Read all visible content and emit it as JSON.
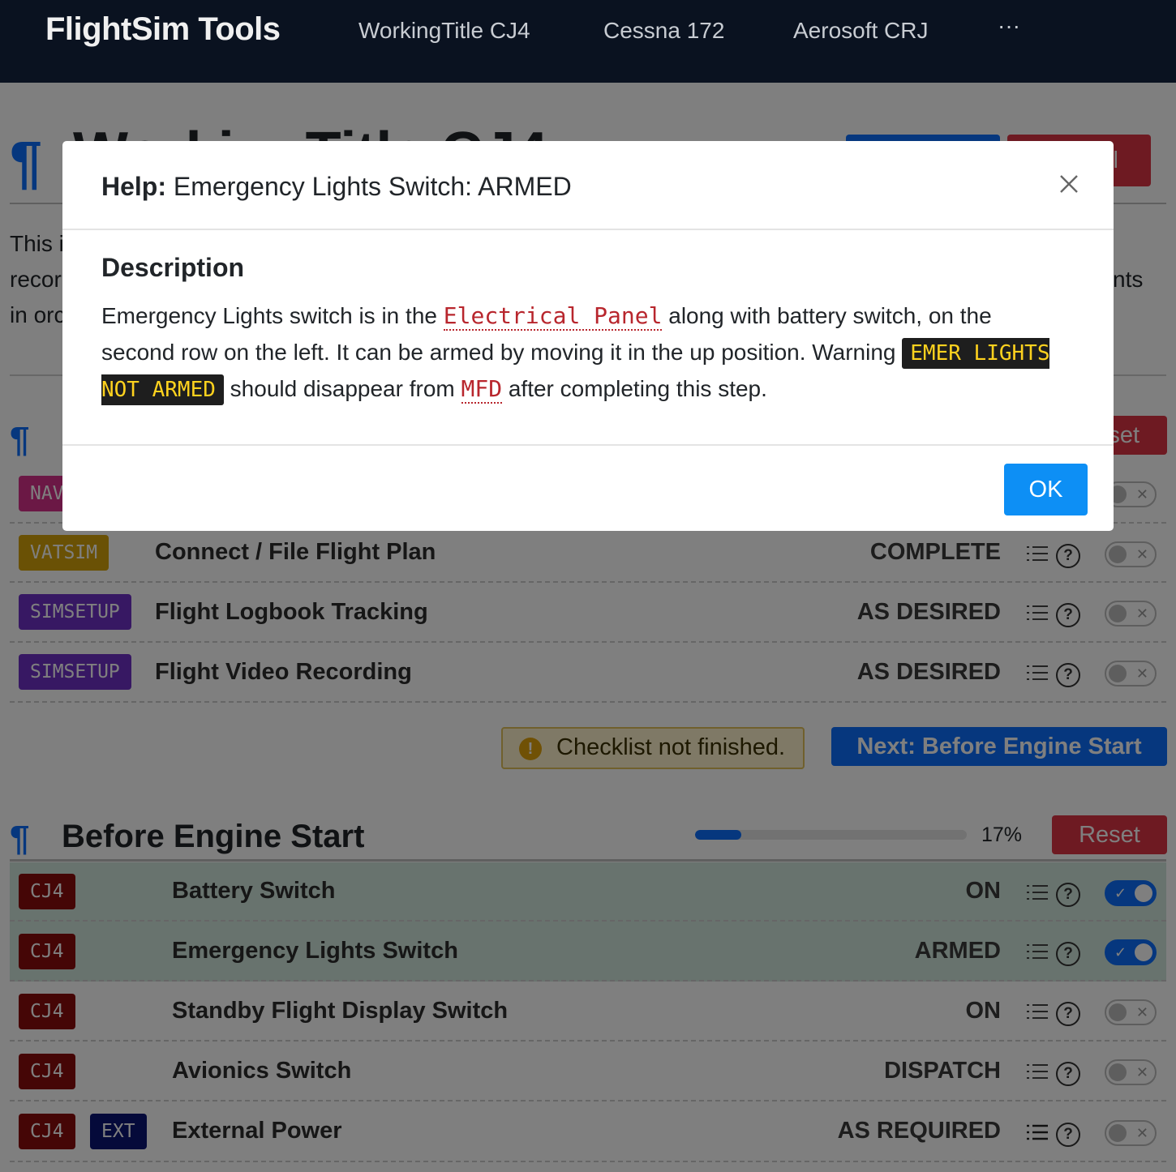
{
  "navbar": {
    "brand": "FlightSim Tools",
    "links": [
      "WorkingTitle CJ4",
      "Cessna 172",
      "Aerosoft CRJ",
      "···"
    ]
  },
  "page": {
    "title": "WorkingTitle CJ4",
    "intro_fragments": [
      "This i",
      "recor",
      "in orc",
      "nts"
    ],
    "top_buttons": [
      "",
      "ll"
    ]
  },
  "section1": {
    "reset_label": "set",
    "nav_badge": "NAV",
    "items": [
      {
        "tag": "VATSIM",
        "label": "Connect / File Flight Plan",
        "value": "COMPLETE",
        "checked": false
      },
      {
        "tag": "SIMSETUP",
        "label": "Flight Logbook Tracking",
        "value": "AS DESIRED",
        "checked": false
      },
      {
        "tag": "SIMSETUP",
        "label": "Flight Video Recording",
        "value": "AS DESIRED",
        "checked": false
      }
    ],
    "alert": "Checklist not finished.",
    "alert_icon": "!",
    "next_button": "Next: Before Engine Start"
  },
  "section2": {
    "title": "Before Engine Start",
    "progress": 0.17,
    "progress_label": "17%",
    "reset_label": "Reset",
    "items": [
      {
        "tags": [
          "CJ4"
        ],
        "label": "Battery Switch",
        "value": "ON",
        "checked": true
      },
      {
        "tags": [
          "CJ4"
        ],
        "label": "Emergency Lights Switch",
        "value": "ARMED",
        "checked": true
      },
      {
        "tags": [
          "CJ4"
        ],
        "label": "Standby Flight Display Switch",
        "value": "ON",
        "checked": false
      },
      {
        "tags": [
          "CJ4"
        ],
        "label": "Avionics Switch",
        "value": "DISPATCH",
        "checked": false
      },
      {
        "tags": [
          "CJ4",
          "EXT"
        ],
        "label": "External Power",
        "value": "AS REQUIRED",
        "checked": false
      }
    ]
  },
  "modal": {
    "title_prefix": "Help:",
    "title": "Emergency Lights Switch: ARMED",
    "heading": "Description",
    "text_1": "Emergency Lights switch is in the ",
    "code_1": "Electrical Panel",
    "text_2": " along with battery switch, on the second row on the left. It can be armed by moving it in the up position. Warning ",
    "warning": "EMER LIGHTS NOT ARMED",
    "text_3": " should disappear from ",
    "code_2": "MFD",
    "text_4": " after completing this step.",
    "ok_label": "OK"
  },
  "icons": {
    "close": "close-icon",
    "help": "question-circle-icon",
    "list": "list-icon",
    "toggle_check": "✓",
    "toggle_x": "✕"
  },
  "colors": {
    "accent": "#0d6efd",
    "danger": "#dc3545",
    "navbar": "#0a1220",
    "checked_row": "#d1e7dd"
  }
}
